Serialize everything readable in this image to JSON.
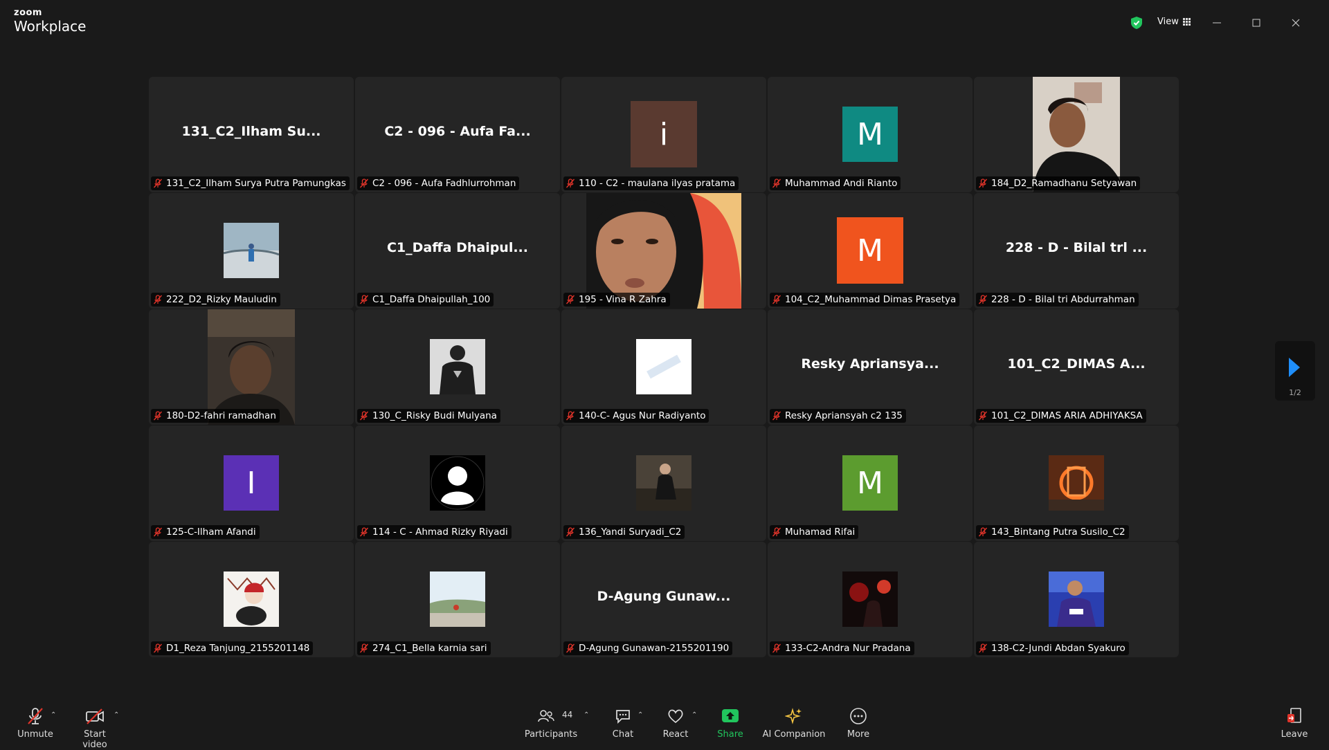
{
  "app": {
    "brand_top": "zoom",
    "brand_bottom": "Workplace"
  },
  "titlebar": {
    "view_label": "View"
  },
  "colors": {
    "muted_red": "#e0342a",
    "share_green": "#21c55d",
    "nav_blue": "#1f8efa",
    "ai_yellow": "#f5c542"
  },
  "tiles": [
    {
      "tile_name": "131_C2_Ilham Su...",
      "label": "131_C2_Ilham Surya Putra Pamungkas"
    },
    {
      "tile_name": "C2 - 096 - Aufa Fa...",
      "label": "C2 - 096 - Aufa Fadhlurrohman"
    },
    {
      "avatar_letter": "i",
      "avatar_color": "#5a3a30",
      "label": "110 - C2 - maulana ilyas pratama"
    },
    {
      "avatar_letter": "M",
      "avatar_color": "#0f8a82",
      "label": "Muhammad Andi Rianto"
    },
    {
      "label": "184_D2_Ramadhanu Setyawan"
    },
    {
      "label": "222_D2_Rizky Mauludin"
    },
    {
      "tile_name": "C1_Daffa Dhaipul...",
      "label": "C1_Daffa Dhaipullah_100"
    },
    {
      "label": "195 - Vina R Zahra"
    },
    {
      "avatar_letter": "M",
      "avatar_color": "#f0541e",
      "label": "104_C2_Muhammad Dimas Prasetya"
    },
    {
      "tile_name": "228 - D - Bilal trl ...",
      "label": "228 - D - Bilal tri Abdurrahman"
    },
    {
      "label": "180-D2-fahri ramadhan"
    },
    {
      "label": "130_C_Risky Budi Mulyana"
    },
    {
      "label": "140-C- Agus Nur Radiyanto"
    },
    {
      "tile_name": "Resky Apriansya...",
      "label": "Resky Apriansyah c2 135"
    },
    {
      "tile_name": "101_C2_DIMAS A...",
      "label": "101_C2_DIMAS ARIA ADHIYAKSA"
    },
    {
      "avatar_letter": "I",
      "avatar_color": "#5b30b5",
      "label": "125-C-Ilham Afandi"
    },
    {
      "label": "114 - C - Ahmad Rizky Riyadi"
    },
    {
      "label": "136_Yandi Suryadi_C2"
    },
    {
      "avatar_letter": "M",
      "avatar_color": "#5c9c2f",
      "label": "Muhamad Rifai"
    },
    {
      "label": "143_Bintang Putra Susilo_C2"
    },
    {
      "label": "D1_Reza Tanjung_2155201148"
    },
    {
      "label": "274_C1_Bella karnia sari"
    },
    {
      "tile_name": "D-Agung Gunaw...",
      "label": "D-Agung Gunawan-2155201190"
    },
    {
      "label": "133-C2-Andra Nur Pradana"
    },
    {
      "label": "138-C2-Jundi Abdan Syakuro"
    }
  ],
  "pager": {
    "page": "1/2"
  },
  "toolbar": {
    "unmute": "Unmute",
    "start_video": "Start video",
    "participants": "Participants",
    "participants_count": "44",
    "chat": "Chat",
    "react": "React",
    "share": "Share",
    "ai_companion": "AI Companion",
    "more": "More",
    "leave": "Leave"
  }
}
